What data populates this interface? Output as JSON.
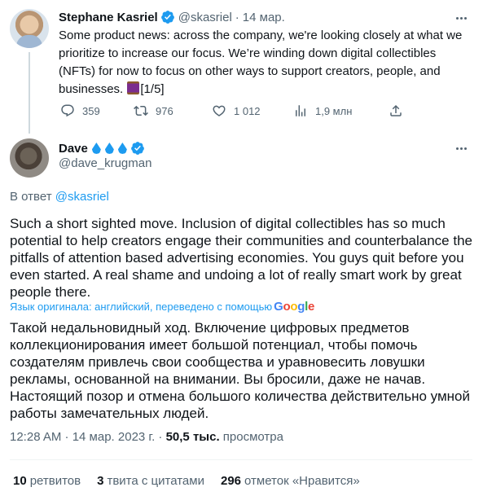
{
  "parent_tweet": {
    "author_name": "Stephane Kasriel",
    "handle": "@skasriel",
    "separator": "·",
    "date": "14 мар.",
    "text": "Some product news: across the company, we're looking closely at what we prioritize to increase our focus. We’re winding down digital collectibles (NFTs) for now to focus on other ways to support creators, people, and businesses.",
    "text_suffix": "[1/5]",
    "actions": {
      "replies": "359",
      "retweets": "976",
      "likes": "1 012",
      "views": "1,9 млн"
    },
    "verified_color": "#1d9bf0"
  },
  "main_tweet": {
    "author_name": "Dave",
    "handle": "@dave_krugman",
    "reply_prefix": "В ответ",
    "reply_to": "@skasriel",
    "text": "Such a short sighted move. Inclusion of digital collectibles has so much potential to help creators engage their communities and counterbalance the pitfalls of attention based advertising economies. You guys quit before you even started. A real shame and undoing a lot of really smart work by great people there.",
    "translation_note": "Язык оригинала: английский, переведено с помощью",
    "translation_provider": [
      "G",
      "o",
      "o",
      "g",
      "l",
      "e"
    ],
    "translated_text": "Такой недальновидный ход. Включение цифровых предметов коллекционирования имеет большой потенциал, чтобы помочь создателям привлечь свои сообщества и уравновесить ловушки рекламы, основанной на внимании. Вы бросили, даже не начав. Настоящий позор и отмена большого количества действительно умной работы замечательных людей.",
    "timestamp": "12:28 AM · 14 мар. 2023 г. ·",
    "views_count": "50,5 тыс.",
    "views_label": "просмотра",
    "stats": {
      "retweets_count": "10",
      "retweets_label": "ретвитов",
      "quotes_count": "3",
      "quotes_label": "твита с цитатами",
      "likes_count": "296",
      "likes_label": "отметок «Нравится»"
    }
  },
  "colors": {
    "accent": "#1d9bf0",
    "secondary_text": "#536471",
    "primary_text": "#0f1419"
  }
}
